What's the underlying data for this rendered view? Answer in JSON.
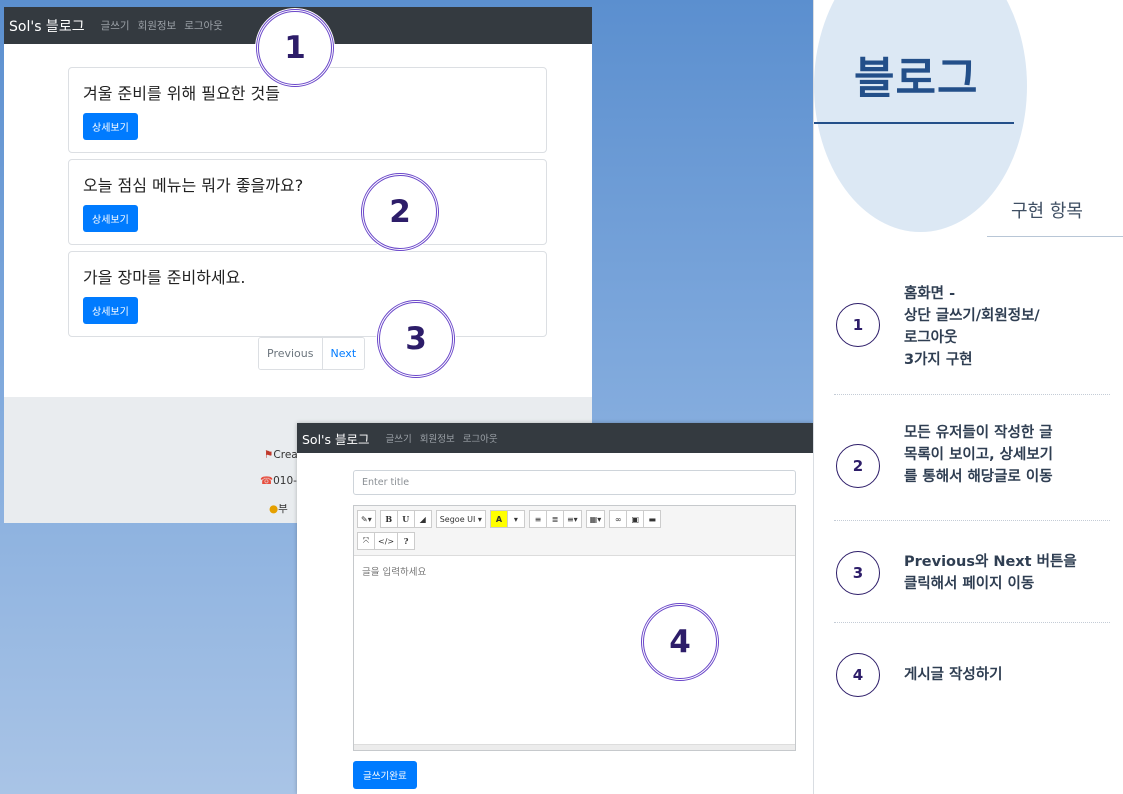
{
  "blog_list": {
    "brand": "Sol's 블로그",
    "nav": [
      "글쓰기",
      "회원정보",
      "로그아웃"
    ],
    "posts": [
      {
        "title": "겨울 준비를 위해 필요한 것들",
        "button": "상세보기"
      },
      {
        "title": "오늘 점심 메뉴는 뭐가 좋을까요?",
        "button": "상세보기"
      },
      {
        "title": "가을 장마를 준비하세요.",
        "button": "상세보기"
      }
    ],
    "pagination": {
      "previous": "Previous",
      "next": "Next"
    },
    "footer": [
      "Crea",
      "010-",
      "부"
    ]
  },
  "write_page": {
    "brand": "Sol's 블로그",
    "nav": [
      "글쓰기",
      "회원정보",
      "로그아웃"
    ],
    "title_placeholder": "Enter title",
    "toolbar": {
      "row1": [
        "✎▾",
        "B",
        "U",
        "◢",
        "Segoe UI ▾",
        "A",
        "▾",
        "≡",
        "≣",
        "≡▾",
        "▦▾",
        "∞",
        "▣",
        "▬"
      ],
      "row2": [
        "⤧",
        "</>",
        "?"
      ]
    },
    "body_placeholder": "글을 입력하세요",
    "submit": "글쓰기완료"
  },
  "markers": [
    "1",
    "2",
    "3",
    "4"
  ],
  "panel": {
    "title": "블로그",
    "section_title": "구현 항목",
    "items": [
      {
        "num": "1",
        "lines": [
          "홈화면 -",
          "상단 글쓰기/회원정보/",
          "로그아웃",
          "3가지 구현"
        ]
      },
      {
        "num": "2",
        "lines": [
          "모든 유저들이 작성한 글",
          "목록이 보이고, 상세보기",
          "를 통해서 해당글로 이동"
        ]
      },
      {
        "num": "3",
        "lines": [
          "Previous와 Next 버튼을",
          "클릭해서 페이지 이동"
        ]
      },
      {
        "num": "4",
        "lines": [
          "게시글 작성하기"
        ]
      }
    ]
  },
  "colors": {
    "primary": "#007bff",
    "navbar": "#343a40",
    "accent": "#234f89",
    "marker": "#6a47c9"
  }
}
